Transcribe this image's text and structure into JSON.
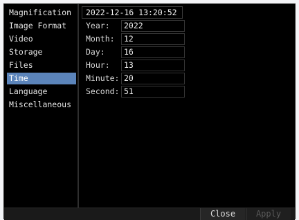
{
  "sidebar": {
    "items": [
      {
        "label": "Magnification"
      },
      {
        "label": "Image Format"
      },
      {
        "label": "Video"
      },
      {
        "label": "Storage"
      },
      {
        "label": "Files"
      },
      {
        "label": "Time"
      },
      {
        "label": "Language"
      },
      {
        "label": "Miscellaneous"
      }
    ],
    "active": "Time"
  },
  "time": {
    "current": "2022-12-16 13:20:52",
    "fields": [
      {
        "label": "Year:",
        "value": "2022"
      },
      {
        "label": "Month:",
        "value": "12"
      },
      {
        "label": "Day:",
        "value": "16"
      },
      {
        "label": "Hour:",
        "value": "13"
      },
      {
        "label": "Minute:",
        "value": "20"
      },
      {
        "label": "Second:",
        "value": "51"
      }
    ]
  },
  "footer": {
    "close_label": "Close",
    "apply_label": "Apply"
  },
  "colors": {
    "active_item": "#5b84ba",
    "background": "#000000"
  }
}
